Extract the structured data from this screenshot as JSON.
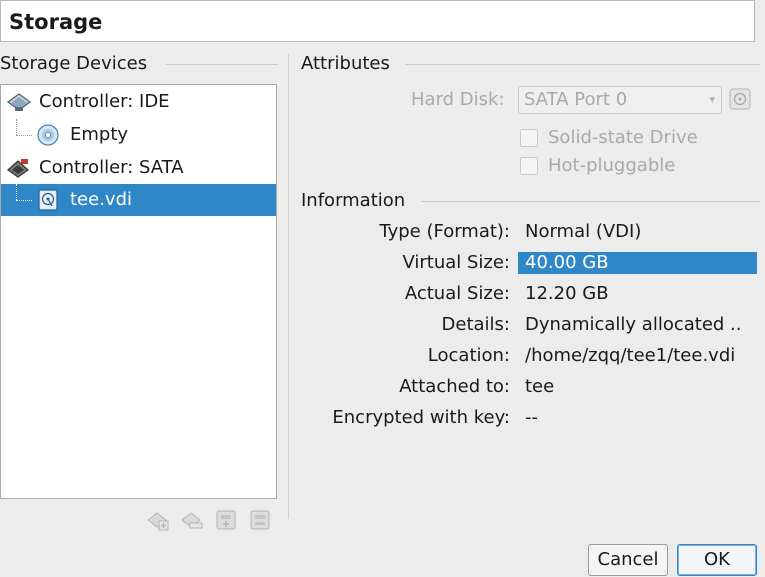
{
  "dialog": {
    "title": "Storage"
  },
  "storage_devices": {
    "label": "Storage Devices",
    "tree": [
      {
        "label": "Controller: IDE",
        "icon": "ide-controller-icon"
      },
      {
        "label": "Empty",
        "icon": "optical-disc-icon"
      },
      {
        "label": "Controller: SATA",
        "icon": "sata-controller-icon"
      },
      {
        "label": "tee.vdi",
        "icon": "hard-disk-icon",
        "selected": true
      }
    ],
    "toolbar": [
      {
        "name": "add-attachment-icon"
      },
      {
        "name": "remove-attachment-icon"
      },
      {
        "name": "add-controller-icon"
      },
      {
        "name": "remove-controller-icon"
      }
    ]
  },
  "attributes": {
    "label": "Attributes",
    "hard_disk_label": "Hard Disk:",
    "hard_disk_value": "SATA Port 0",
    "solid_state_label": "Solid-state Drive",
    "hot_pluggable_label": "Hot-pluggable"
  },
  "information": {
    "label": "Information",
    "rows": [
      {
        "key": "Type (Format):",
        "value": "Normal (VDI)"
      },
      {
        "key": "Virtual Size:",
        "value": "40.00 GB"
      },
      {
        "key": "Actual Size:",
        "value": "12.20 GB"
      },
      {
        "key": "Details:",
        "value": "Dynamically allocated .."
      },
      {
        "key": "Location:",
        "value": "/home/zqq/tee1/tee.vdi"
      },
      {
        "key": "Attached to:",
        "value": "tee"
      },
      {
        "key": "Encrypted with key:",
        "value": "--"
      }
    ]
  },
  "buttons": {
    "cancel": "Cancel",
    "ok": "OK"
  },
  "colors": {
    "selection": "#3087c7",
    "panel_bg": "#ececec"
  }
}
